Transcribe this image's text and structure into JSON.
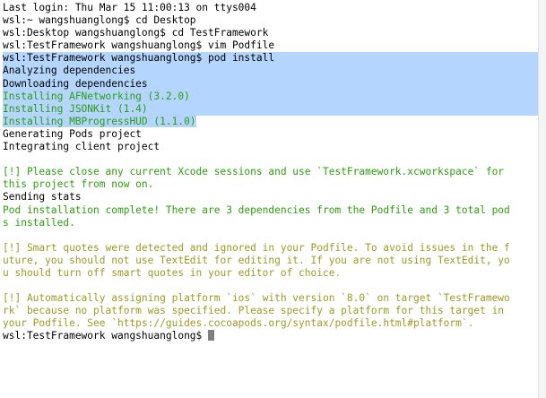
{
  "terminal": {
    "prompt": "wsl:TestFramework wangshuanglong$ ",
    "lines": [
      "Last login: Thu Mar 15 11:00:13 on ttys004",
      "wsl:~ wangshuanglong$ cd Desktop",
      "wsl:Desktop wangshuanglong$ cd TestFramework",
      "wsl:TestFramework wangshuanglong$ vim Podfile",
      "wsl:TestFramework wangshuanglong$ pod install",
      "Analyzing dependencies",
      "Downloading dependencies",
      "Installing AFNetworking (3.2.0)",
      "Installing JSONKit (1.4)",
      "Installing MBProgressHUD (1.1.0)",
      "Generating Pods project",
      "Integrating client project",
      "",
      "[!] Please close any current Xcode sessions and use `TestFramework.xcworkspace` for",
      "this project from now on.",
      "Sending stats",
      "Pod installation complete! There are 3 dependencies from the Podfile and 3 total pod",
      "s installed.",
      "",
      "[!] Smart quotes were detected and ignored in your Podfile. To avoid issues in the f",
      "uture, you should not use TextEdit for editing it. If you are not using TextEdit, yo",
      "u should turn off smart quotes in your editor of choice.",
      "",
      "[!] Automatically assigning platform `ios` with version `8.0` on target `TestFramewo",
      "rk` because no platform was specified. Please specify a platform for this target in",
      "your Podfile. See `https://guides.cocoapods.org/syntax/podfile.html#platform`."
    ]
  },
  "colors": {
    "background": "#ffffff",
    "text": "#000000",
    "selection": "#b4d5fe",
    "success_green": "#2d9d10",
    "warning_yellow": "#9c9a26",
    "cursor": "#7f7f7f"
  }
}
